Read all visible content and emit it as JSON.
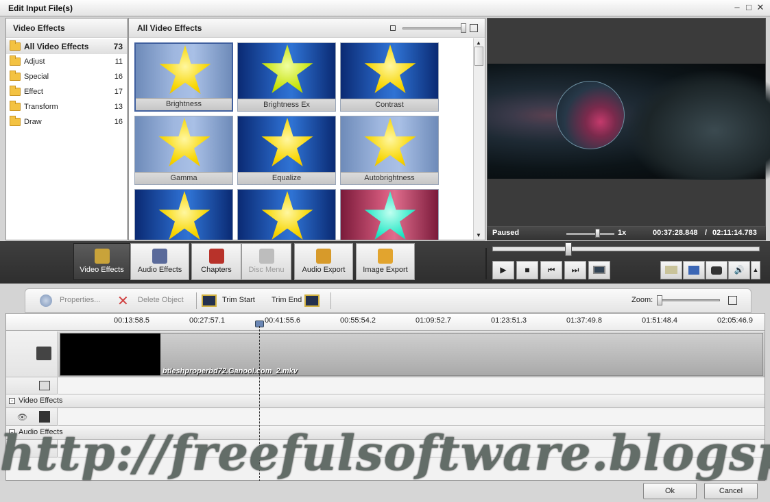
{
  "window": {
    "title": "Edit Input File(s)",
    "min_icon": "minimize-icon",
    "max_icon": "maximize-icon",
    "close_icon": "close-icon"
  },
  "categories_panel": {
    "header": "Video Effects",
    "items": [
      {
        "label": "All Video Effects",
        "count": "73",
        "selected": true
      },
      {
        "label": "Adjust",
        "count": "11"
      },
      {
        "label": "Special",
        "count": "16"
      },
      {
        "label": "Effect",
        "count": "17"
      },
      {
        "label": "Transform",
        "count": "13"
      },
      {
        "label": "Draw",
        "count": "16"
      }
    ]
  },
  "effects_panel": {
    "header": "All Video Effects",
    "effects": [
      {
        "label": "Brightness",
        "selected": true
      },
      {
        "label": "Brightness Ex"
      },
      {
        "label": "Contrast"
      },
      {
        "label": "Gamma"
      },
      {
        "label": "Equalize"
      },
      {
        "label": "Autobrightness"
      },
      {
        "label": ""
      },
      {
        "label": ""
      },
      {
        "label": ""
      }
    ]
  },
  "player": {
    "status": "Paused",
    "speed": "1x",
    "current_time": "00:37:28.848",
    "separator": "/",
    "total_time": "02:11:14.783"
  },
  "tabs": {
    "video_effects": "Video Effects",
    "audio_effects": "Audio Effects",
    "chapters": "Chapters",
    "disc_menu": "Disc Menu",
    "audio_export": "Audio Export",
    "image_export": "Image Export"
  },
  "player_controls": {
    "play": "▶",
    "stop": "■",
    "prev": "⏮",
    "next": "⏭"
  },
  "edit_toolbar": {
    "properties": "Properties...",
    "delete": "Delete Object",
    "trim_start": "Trim Start",
    "trim_end": "Trim End",
    "zoom": "Zoom:"
  },
  "timeline": {
    "ticks": [
      "00:13:58.5",
      "00:27:57.1",
      "00:41:55.6",
      "00:55:54.2",
      "01:09:52.7",
      "01:23:51.3",
      "01:37:49.8",
      "01:51:48.4",
      "02:05:46.9"
    ],
    "clip_name": "btleshproperbd72.Ganool.com_2.mkv",
    "video_effects_group": "Video Effects",
    "audio_effects_group": "Audio Effects"
  },
  "dialog": {
    "ok": "Ok",
    "cancel": "Cancel"
  },
  "watermark": "http://freefulsoftware.blogspot.com/"
}
